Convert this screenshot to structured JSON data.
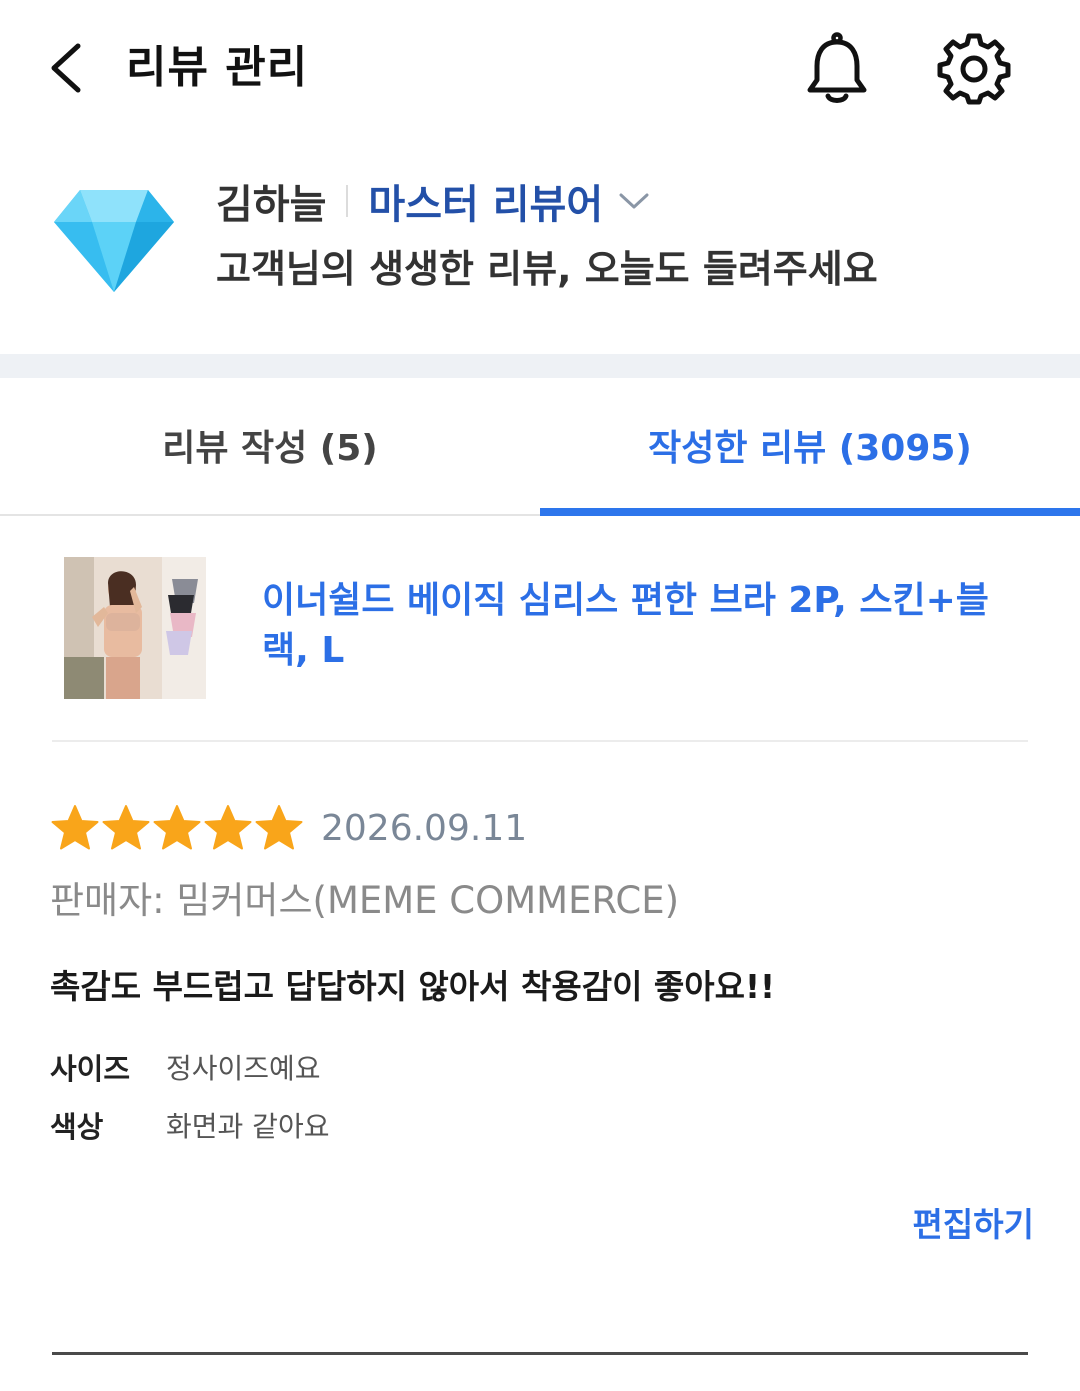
{
  "header": {
    "title": "리뷰 관리",
    "back_icon": "chevron-left-icon",
    "notification_icon": "bell-icon",
    "settings_icon": "gear-icon"
  },
  "profile": {
    "name": "김하늘",
    "grade": "마스터 리뷰어",
    "message": "고객님의 생생한 리뷰, 오늘도 들려주세요",
    "badge_icon": "diamond-icon",
    "grade_color": "#2350a8"
  },
  "tabs": [
    {
      "label": "리뷰 작성 (5)",
      "active": false
    },
    {
      "label": "작성한 리뷰 (3095)",
      "active": true
    }
  ],
  "accent_color": "#2d76ec",
  "review": {
    "product_name": "이너쉴드 베이직 심리스 편한 브라 2P, 스킨+블랙, L",
    "rating": 5,
    "rating_max": 5,
    "star_color": "#f9a51a",
    "date": "2026.09.11",
    "seller": "판매자: 밈커머스(MEME COMMERCE)",
    "text": "촉감도 부드럽고 답답하지 않아서 착용감이 좋아요!!",
    "attributes": [
      {
        "label": "사이즈",
        "value": "정사이즈예요"
      },
      {
        "label": "색상",
        "value": "화면과 같아요"
      }
    ],
    "edit_label": "편집하기"
  }
}
